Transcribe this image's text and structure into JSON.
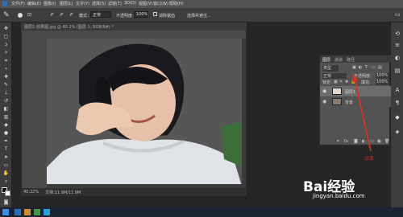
{
  "menubar": {
    "items": [
      "文件(F)",
      "编辑(E)",
      "图像(I)",
      "图层(L)",
      "文字(Y)",
      "选择(S)",
      "滤镜(T)",
      "3D(D)",
      "视图(V)",
      "窗口(W)",
      "帮助(H)"
    ]
  },
  "options": {
    "mode_label": "模式：",
    "mode_value": "正常",
    "opacity_label": "不透明度：",
    "opacity_value": "100%",
    "antialias_label": "消除锯齿",
    "refine_label": "选择并遮住..."
  },
  "document": {
    "title": "图层1-效果图.jpg @ 40.2% (图层 1, RGB/8#) *",
    "zoom": "40.22%",
    "doc_size": "文档:11.9M/11.9M"
  },
  "layers_panel": {
    "tabs": [
      "图层",
      "通道",
      "路径"
    ],
    "kind_label": "类型",
    "blend_mode": "正常",
    "opacity_label": "不透明度:",
    "opacity_value": "100%",
    "lock_label": "锁定:",
    "fill_label": "填充:",
    "fill_value": "100%",
    "layers": [
      {
        "name": "图层1"
      },
      {
        "name": "背景"
      }
    ]
  },
  "annotation": {
    "text": "点击",
    "color": "#e0301e"
  },
  "watermark": {
    "logo": "Bai经验",
    "url": "jingyan.baidu.com"
  },
  "colors": {
    "accent": "#e0301e",
    "panel": "#535353",
    "ui_dark": "#3d3d3d"
  }
}
